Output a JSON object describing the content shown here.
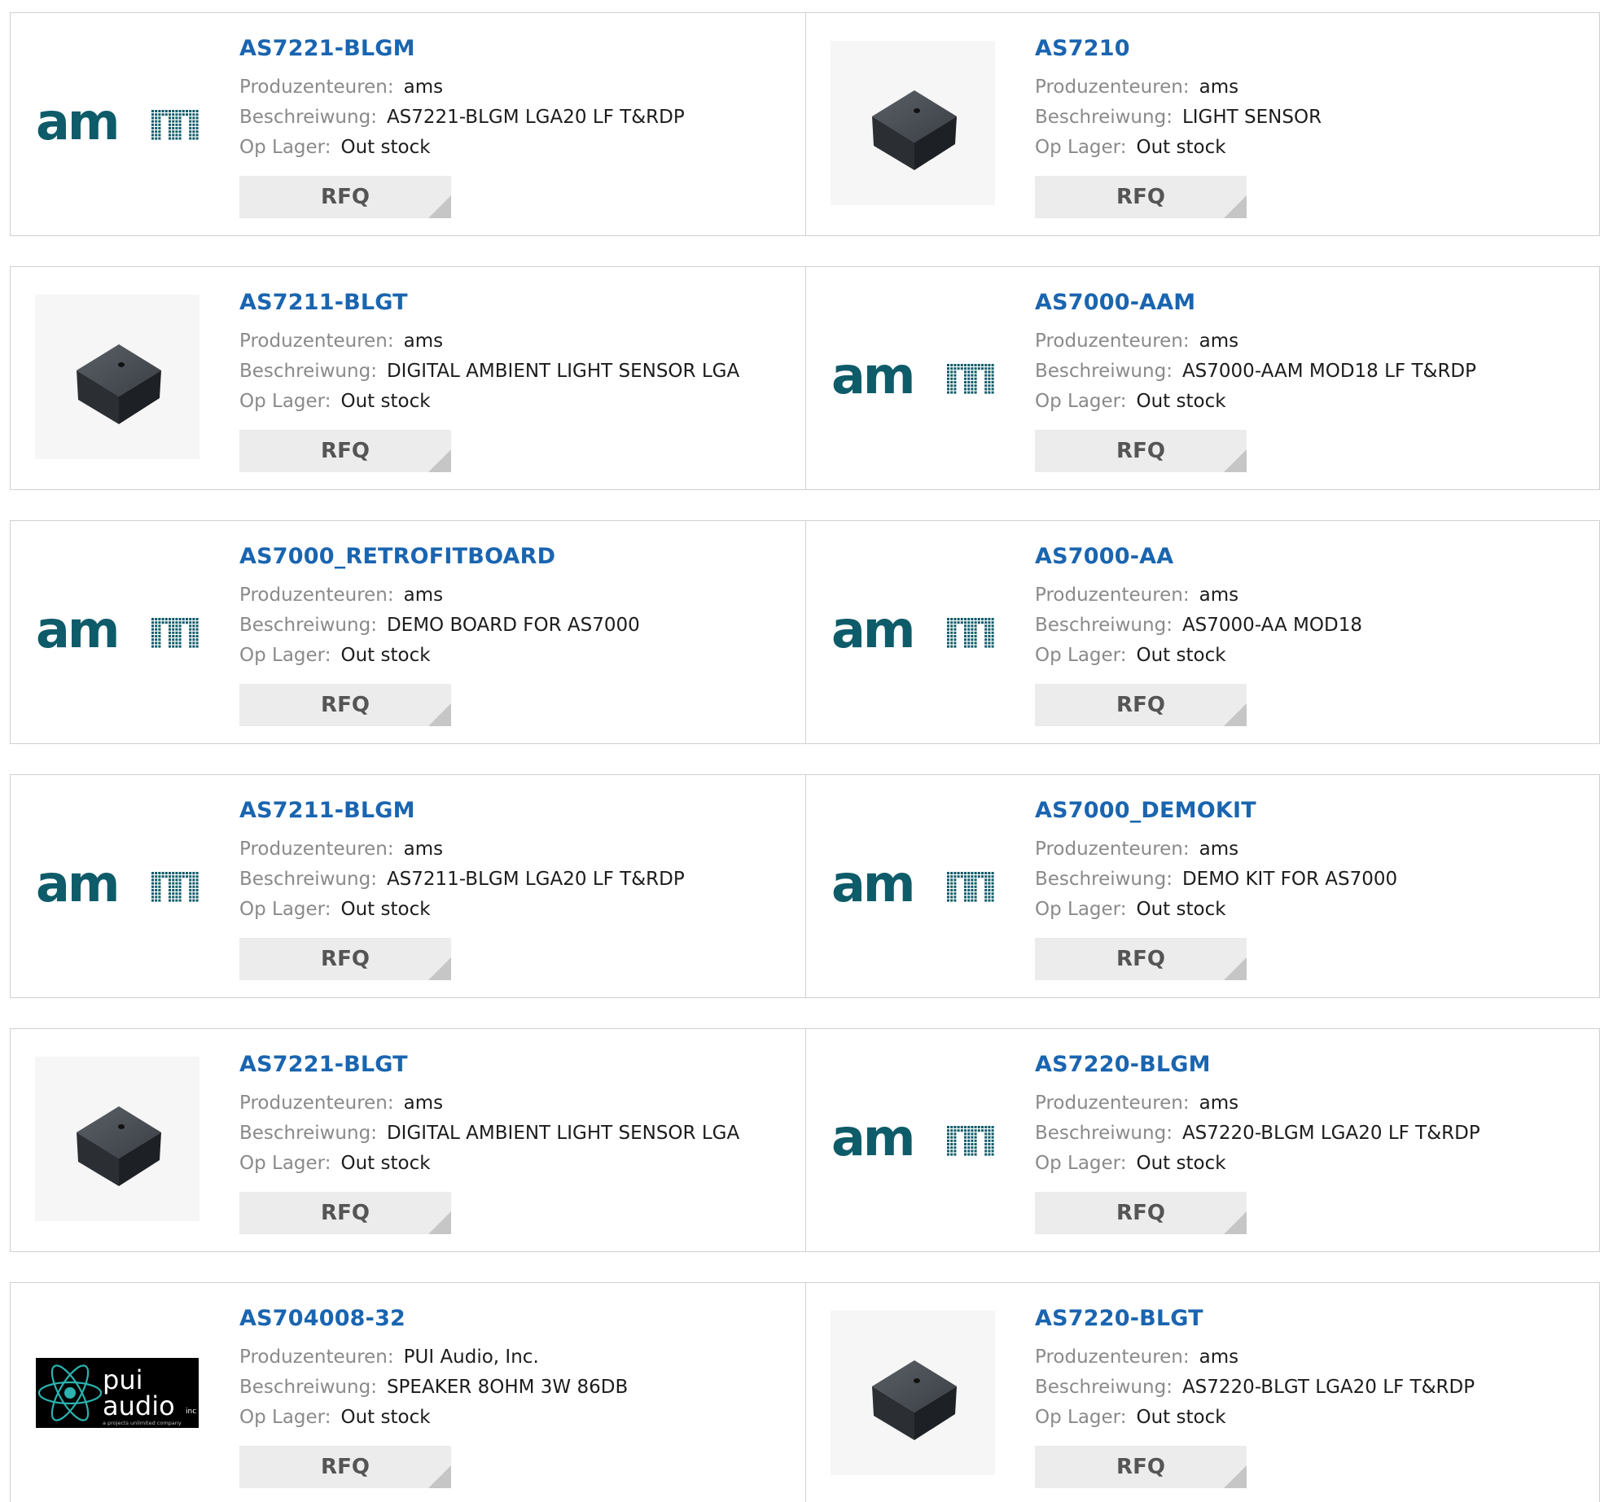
{
  "labels": {
    "manufacturer": "Produzenteuren:",
    "description": "Beschreiwung:",
    "stock": "Op Lager:",
    "rfq": "RFQ"
  },
  "logos": {
    "ams": "am",
    "pui_top": "pui",
    "pui_bottom": "audio",
    "pui_inc": "inc",
    "pui_tagline": "a projects unlimited company"
  },
  "colors": {
    "title": "#1a65b0",
    "ams_logo": "#0e5b69",
    "rfq_bg": "#ececec"
  },
  "products": [
    {
      "part": "AS7221-BLGM",
      "manufacturer": "ams",
      "description": "AS7221-BLGM LGA20 LF T&RDP",
      "stock": "Out stock",
      "image": "ams-logo"
    },
    {
      "part": "AS7210",
      "manufacturer": "ams",
      "description": "LIGHT SENSOR",
      "stock": "Out stock",
      "image": "chip"
    },
    {
      "part": "AS7211-BLGT",
      "manufacturer": "ams",
      "description": "DIGITAL AMBIENT LIGHT SENSOR LGA",
      "stock": "Out stock",
      "image": "chip"
    },
    {
      "part": "AS7000-AAM",
      "manufacturer": "ams",
      "description": "AS7000-AAM MOD18 LF T&RDP",
      "stock": "Out stock",
      "image": "ams-logo"
    },
    {
      "part": "AS7000_RETROFITBOARD",
      "manufacturer": "ams",
      "description": "DEMO BOARD FOR AS7000",
      "stock": "Out stock",
      "image": "ams-logo"
    },
    {
      "part": "AS7000-AA",
      "manufacturer": "ams",
      "description": "AS7000-AA MOD18",
      "stock": "Out stock",
      "image": "ams-logo"
    },
    {
      "part": "AS7211-BLGM",
      "manufacturer": "ams",
      "description": "AS7211-BLGM LGA20 LF T&RDP",
      "stock": "Out stock",
      "image": "ams-logo"
    },
    {
      "part": "AS7000_DEMOKIT",
      "manufacturer": "ams",
      "description": "DEMO KIT FOR AS7000",
      "stock": "Out stock",
      "image": "ams-logo"
    },
    {
      "part": "AS7221-BLGT",
      "manufacturer": "ams",
      "description": "DIGITAL AMBIENT LIGHT SENSOR LGA",
      "stock": "Out stock",
      "image": "chip"
    },
    {
      "part": "AS7220-BLGM",
      "manufacturer": "ams",
      "description": "AS7220-BLGM LGA20 LF T&RDP",
      "stock": "Out stock",
      "image": "ams-logo"
    },
    {
      "part": "AS704008-32",
      "manufacturer": "PUI Audio, Inc.",
      "description": "SPEAKER 8OHM 3W 86DB",
      "stock": "Out stock",
      "image": "pui-logo"
    },
    {
      "part": "AS7220-BLGT",
      "manufacturer": "ams",
      "description": "AS7220-BLGT LGA20 LF T&RDP",
      "stock": "Out stock",
      "image": "chip"
    }
  ]
}
